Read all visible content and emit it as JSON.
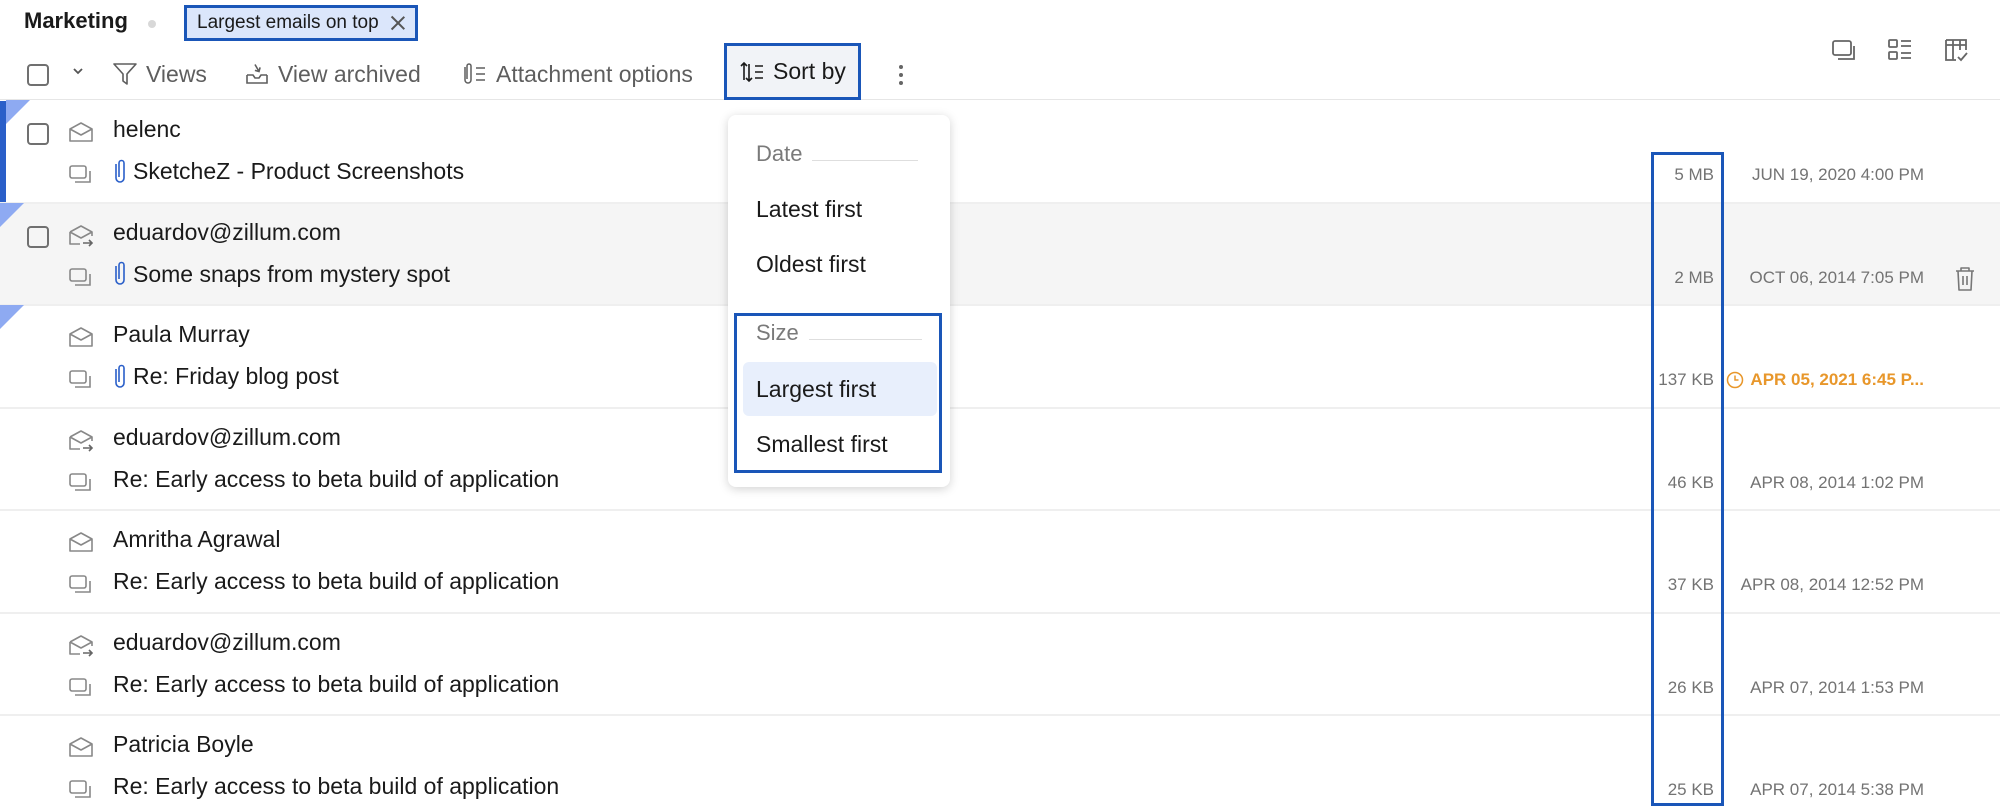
{
  "header": {
    "folder_title": "Marketing",
    "filter_chip": "Largest emails on top"
  },
  "toolbar": {
    "views": "Views",
    "view_archived": "View archived",
    "attachment_options": "Attachment options",
    "sort_by": "Sort by"
  },
  "sort_menu": {
    "date_group": "Date",
    "latest_first": "Latest first",
    "oldest_first": "Oldest first",
    "size_group": "Size",
    "largest_first": "Largest first",
    "smallest_first": "Smallest first",
    "selected": "Largest first"
  },
  "colors": {
    "accent": "#1a56b8",
    "unread": "#2a5fc9",
    "flag": "#8eaaf2",
    "reminder": "#e8972b"
  },
  "emails": [
    {
      "sender": "helenc",
      "subject": "SketcheZ - Product Screenshots",
      "size": "5 MB",
      "date": "JUN 19, 2020 4:00 PM",
      "attachment": true,
      "icon": "envelope-open-icon"
    },
    {
      "sender": "eduardov@zillum.com",
      "subject": "Some snaps from mystery spot",
      "size": "2 MB",
      "date": "OCT 06, 2014 7:05 PM",
      "attachment": true,
      "icon": "envelope-forwarded-icon"
    },
    {
      "sender": "Paula Murray",
      "subject": "Re: Friday blog post",
      "size": "137 KB",
      "date": "APR 05, 2021 6:45 P...",
      "attachment": true,
      "icon": "envelope-open-icon",
      "reminder": true
    },
    {
      "sender": "eduardov@zillum.com",
      "subject": "Re: Early access to beta build of application",
      "size": "46 KB",
      "date": "APR 08, 2014 1:02 PM",
      "attachment": false,
      "icon": "envelope-forwarded-icon"
    },
    {
      "sender": "Amritha Agrawal",
      "subject": "Re: Early access to beta build of application",
      "size": "37 KB",
      "date": "APR 08, 2014 12:52 PM",
      "attachment": false,
      "icon": "envelope-open-icon"
    },
    {
      "sender": "eduardov@zillum.com",
      "subject": "Re: Early access to beta build of application",
      "size": "26 KB",
      "date": "APR 07, 2014 1:53 PM",
      "attachment": false,
      "icon": "envelope-forwarded-icon"
    },
    {
      "sender": "Patricia Boyle",
      "subject": "Re: Early access to beta build of application",
      "size": "25 KB",
      "date": "APR 07, 2014 5:38 PM",
      "attachment": false,
      "icon": "envelope-open-icon"
    }
  ]
}
